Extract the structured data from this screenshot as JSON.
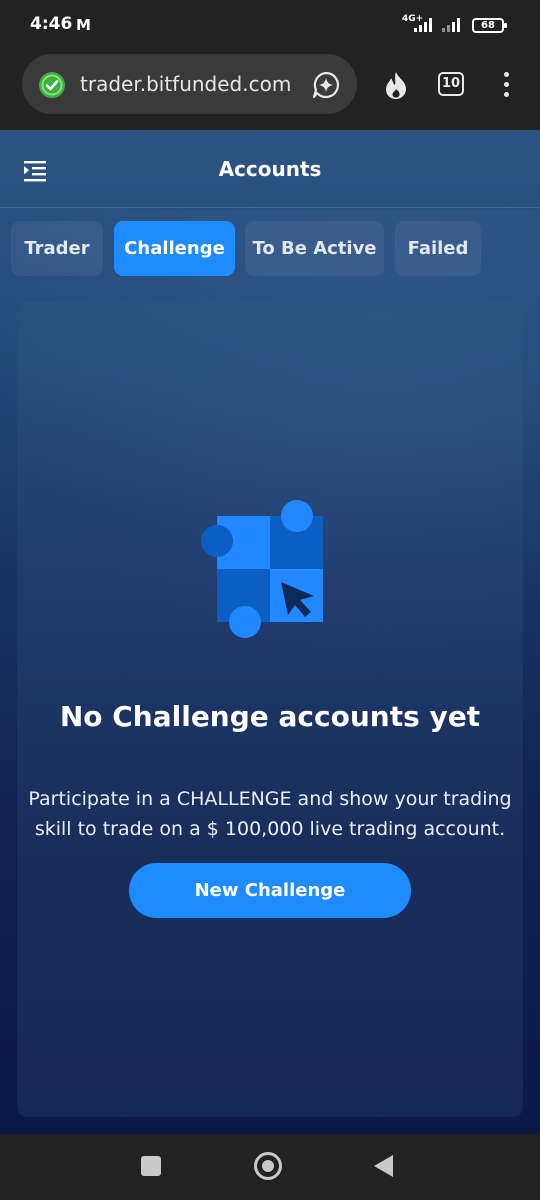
{
  "status_bar": {
    "time": "4:46",
    "mail_icon": "gmail-icon",
    "network": "4G+",
    "battery": "68"
  },
  "browser": {
    "url": "trader.bitfunded.com",
    "tab_count": "10",
    "icons": [
      "shield-check-icon",
      "sparkle-chat-icon",
      "flame-icon",
      "tabs-icon",
      "more-vert-icon"
    ],
    "colors": {
      "bar": "#222222",
      "shield": "#3cb043"
    }
  },
  "header": {
    "title": "Accounts",
    "menu_icon": "menu-collapse-icon"
  },
  "tabs": [
    {
      "label": "Trader",
      "active": false
    },
    {
      "label": "Challenge",
      "active": true
    },
    {
      "label": "To Be Active",
      "active": false
    },
    {
      "label": "Failed",
      "active": false
    }
  ],
  "empty_state": {
    "icon": "puzzle-cursor-illustration",
    "title": "No Challenge accounts yet",
    "description": "Participate in a CHALLENGE and show your trading skill to trade on a $ 100,000 live trading account.",
    "button_label": "New Challenge"
  },
  "nav_bar": {
    "icons": [
      "recents-square-icon",
      "home-circle-icon",
      "back-triangle-icon"
    ]
  },
  "theme": {
    "accent": "#1e8cff",
    "text": "#ffffff"
  }
}
